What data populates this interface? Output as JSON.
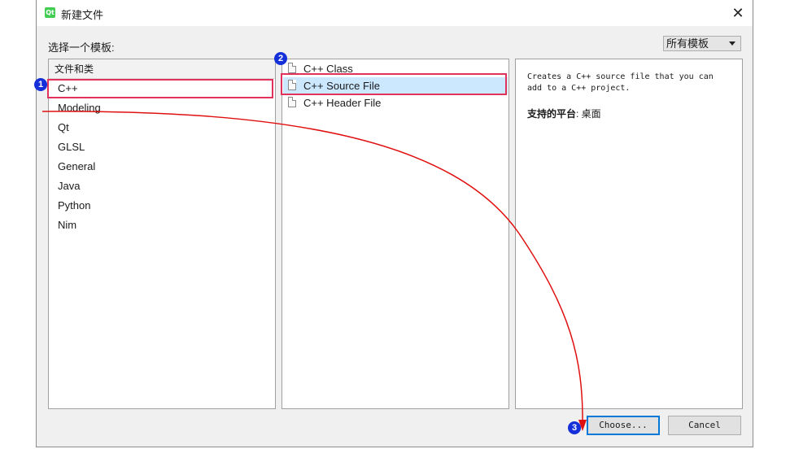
{
  "window": {
    "title": "新建文件",
    "app_icon": "qt-creator-icon",
    "close_glyph": "✕"
  },
  "template_label": "选择一个模板:",
  "filter": {
    "selected": "所有模板"
  },
  "categories": {
    "header": "文件和类",
    "items": [
      "C++",
      "Modeling",
      "Qt",
      "GLSL",
      "General",
      "Java",
      "Python",
      "Nim"
    ],
    "selected_index": 0
  },
  "files": {
    "items": [
      "C++ Class",
      "C++ Source File",
      "C++ Header File"
    ],
    "selected_index": 1
  },
  "description": {
    "text": "Creates a C++ source file that you can add to a C++ project.",
    "platform_label": "支持的平台",
    "platform_value": ": 桌面"
  },
  "buttons": {
    "choose": "Choose...",
    "cancel": "Cancel"
  },
  "annotations": {
    "badges": [
      "1",
      "2",
      "3"
    ],
    "highlight_color": "#e0325a",
    "arrow_color": "#e01010",
    "badge_color": "#1530d8"
  }
}
